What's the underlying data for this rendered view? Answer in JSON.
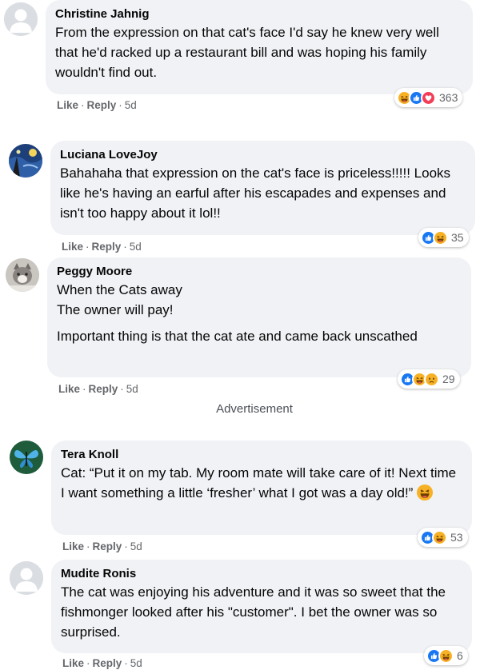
{
  "colors": {
    "bubble": "#f0f2f5",
    "meta_text": "#65676b",
    "like_blue": "#1877f2",
    "love_red": "#f33e58",
    "haha_yellow": "#f7b125"
  },
  "advertisement_label": "Advertisement",
  "comments": [
    {
      "author": "Christine Jahnig",
      "avatar": "default-avatar",
      "paragraphs": [
        "From the expression on that cat's face I'd say he knew very well that he'd racked up a restaurant bill and was hoping his family wouldn't find out."
      ],
      "like_label": "Like",
      "reply_label": "Reply",
      "time": "5d",
      "reactions": [
        "haha",
        "like",
        "love"
      ],
      "reaction_count": "363"
    },
    {
      "author": "Luciana LoveJoy",
      "avatar": "starry-night-avatar",
      "paragraphs": [
        "Bahahaha that expression on the cat's face is priceless!!!!! Looks like he's having an earful after his escapades and expenses and isn't too happy about it lol!!"
      ],
      "like_label": "Like",
      "reply_label": "Reply",
      "time": "5d",
      "reactions": [
        "like",
        "haha"
      ],
      "reaction_count": "35"
    },
    {
      "author": "Peggy Moore",
      "avatar": "cat-photo-avatar",
      "paragraphs": [
        "When the Cats away",
        "The owner will pay!",
        "Important thing is that the cat ate and came back unscathed"
      ],
      "like_label": "Like",
      "reply_label": "Reply",
      "time": "5d",
      "reactions": [
        "like",
        "haha",
        "sad"
      ],
      "reaction_count": "29"
    },
    {
      "author": "Tera Knoll",
      "avatar": "butterfly-avatar",
      "paragraphs": [
        "Cat: “Put it on my tab. My room mate will take care of it! Next time I want something a little ‘fresher’ what I got was a day old!”"
      ],
      "inline_emoji": "laughing-emoji",
      "like_label": "Like",
      "reply_label": "Reply",
      "time": "5d",
      "reactions": [
        "like",
        "haha"
      ],
      "reaction_count": "53"
    },
    {
      "author": "Mudite Ronis",
      "avatar": "default-avatar",
      "paragraphs": [
        "The cat was enjoying his adventure and it was so sweet that the fishmonger looked after his \"customer\". I bet the owner was so surprised."
      ],
      "like_label": "Like",
      "reply_label": "Reply",
      "time": "5d",
      "reactions": [
        "like",
        "haha"
      ],
      "reaction_count": "6"
    }
  ]
}
